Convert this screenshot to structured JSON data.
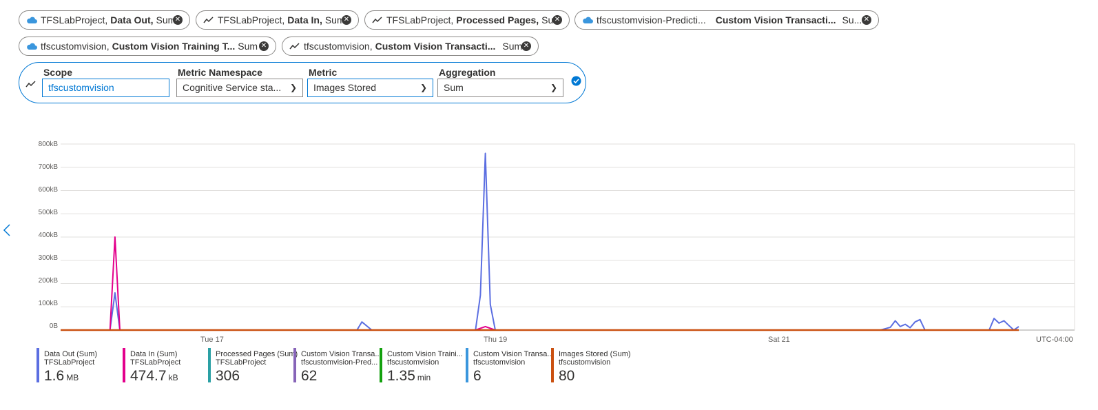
{
  "pills_row1": [
    {
      "icon": "cloud-icon",
      "resource": "TFSLabProject,",
      "metric": "Data Out,",
      "agg": "Sum"
    },
    {
      "icon": "metric-icon",
      "resource": "TFSLabProject,",
      "metric": "Data In,",
      "agg": "Sum"
    },
    {
      "icon": "metric-icon",
      "resource": "TFSLabProject,",
      "metric": "Processed Pages,",
      "agg": "Sum"
    },
    {
      "icon": "cloud-icon",
      "resource": "tfscustomvision-Predicti...",
      "metric": "Custom Vision Transacti...",
      "agg": "Su..."
    }
  ],
  "pills_row2": [
    {
      "icon": "cloud-icon",
      "resource": "tfscustomvision,",
      "metric": "Custom Vision Training T...",
      "agg": "Sum"
    },
    {
      "icon": "metric-icon",
      "resource": "tfscustomvision,",
      "metric": "Custom Vision Transacti...",
      "agg": "Sum"
    }
  ],
  "editor": {
    "scope_label": "Scope",
    "scope_value": "tfscustomvision",
    "namespace_label": "Metric Namespace",
    "namespace_value": "Cognitive Service sta...",
    "metric_label": "Metric",
    "metric_value": "Images Stored",
    "aggregation_label": "Aggregation",
    "aggregation_value": "Sum"
  },
  "timezone": "UTC-04:00",
  "colors": {
    "accent": "#0078d4",
    "data_out": "#5b6ee1",
    "data_in": "#e3008c",
    "processed": "#2aa0a4",
    "cv_pred": "#8764b8",
    "cv_train": "#13a10e",
    "cv_trans": "#3a96dd",
    "images": "#ca5010"
  },
  "legend": [
    {
      "l1": "Data Out (Sum)",
      "l2": "TFSLabProject",
      "value": "1.6",
      "unit": "MB",
      "color": "#5b6ee1"
    },
    {
      "l1": "Data In (Sum)",
      "l2": "TFSLabProject",
      "value": "474.7",
      "unit": "kB",
      "color": "#e3008c"
    },
    {
      "l1": "Processed Pages (Sum)",
      "l2": "TFSLabProject",
      "value": "306",
      "unit": "",
      "color": "#2aa0a4"
    },
    {
      "l1": "Custom Vision Transa...",
      "l2": "tfscustomvision-Pred...",
      "value": "62",
      "unit": "",
      "color": "#8764b8"
    },
    {
      "l1": "Custom Vision Traini...",
      "l2": "tfscustomvision",
      "value": "1.35",
      "unit": "min",
      "color": "#13a10e"
    },
    {
      "l1": "Custom Vision Transa...",
      "l2": "tfscustomvision",
      "value": "6",
      "unit": "",
      "color": "#3a96dd"
    },
    {
      "l1": "Images Stored (Sum)",
      "l2": "tfscustomvision",
      "value": "80",
      "unit": "",
      "color": "#ca5010"
    }
  ],
  "chart_data": {
    "type": "line",
    "y_ticks": [
      "800kB",
      "700kB",
      "600kB",
      "500kB",
      "400kB",
      "300kB",
      "200kB",
      "100kB",
      "0B"
    ],
    "x_ticks": [
      "Tue 17",
      "Thu 19",
      "Sat 21"
    ],
    "ylim_kB": [
      0,
      800
    ],
    "series": [
      {
        "name": "Data Out (Sum)",
        "color": "#5b6ee1",
        "points": [
          [
            0.0,
            0
          ],
          [
            0.05,
            0
          ],
          [
            0.055,
            160
          ],
          [
            0.06,
            0
          ],
          [
            0.3,
            0
          ],
          [
            0.305,
            35
          ],
          [
            0.315,
            0
          ],
          [
            0.42,
            0
          ],
          [
            0.425,
            150
          ],
          [
            0.43,
            760
          ],
          [
            0.435,
            110
          ],
          [
            0.44,
            0
          ],
          [
            0.83,
            0
          ],
          [
            0.84,
            12
          ],
          [
            0.845,
            40
          ],
          [
            0.85,
            15
          ],
          [
            0.855,
            25
          ],
          [
            0.86,
            10
          ],
          [
            0.865,
            35
          ],
          [
            0.87,
            45
          ],
          [
            0.875,
            0
          ],
          [
            0.94,
            0
          ],
          [
            0.945,
            50
          ],
          [
            0.95,
            30
          ],
          [
            0.955,
            40
          ],
          [
            0.96,
            20
          ],
          [
            0.965,
            0
          ],
          [
            0.97,
            15
          ]
        ]
      },
      {
        "name": "Data In (Sum)",
        "color": "#e3008c",
        "points": [
          [
            0.0,
            0
          ],
          [
            0.05,
            0
          ],
          [
            0.055,
            400
          ],
          [
            0.06,
            0
          ],
          [
            0.42,
            0
          ],
          [
            0.43,
            15
          ],
          [
            0.44,
            0
          ],
          [
            0.97,
            0
          ]
        ]
      },
      {
        "name": "Images Stored (Sum)",
        "color": "#ca5010",
        "points": [
          [
            0.0,
            0
          ],
          [
            0.97,
            0
          ]
        ]
      }
    ]
  }
}
